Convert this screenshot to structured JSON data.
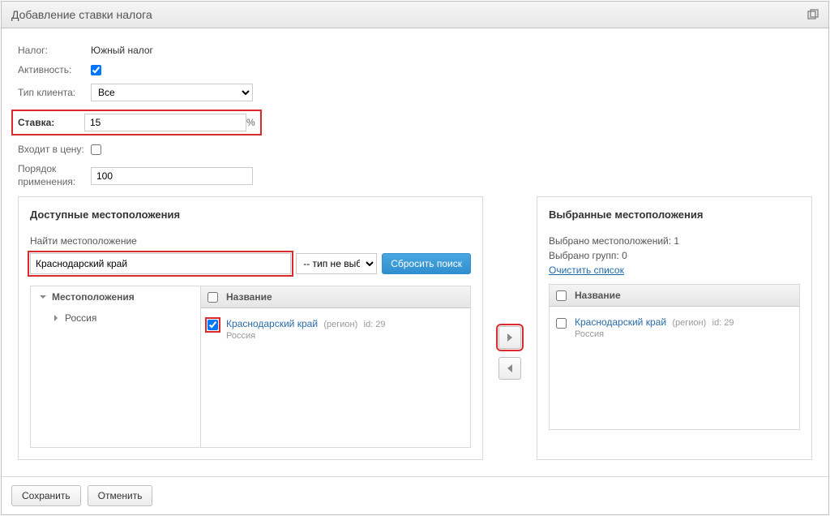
{
  "window": {
    "title": "Добавление ставки налога"
  },
  "form": {
    "tax_label": "Налог:",
    "tax_value": "Южный налог",
    "active_label": "Активность:",
    "active_checked": true,
    "client_type_label": "Тип клиента:",
    "client_type_value": "Все",
    "rate_label": "Ставка:",
    "rate_value": "15",
    "rate_unit": "%",
    "in_price_label": "Входит в цену:",
    "in_price_checked": false,
    "order_label": "Порядок применения:",
    "order_value": "100"
  },
  "left_panel": {
    "title": "Доступные местоположения",
    "search_label": "Найти местоположение",
    "search_value": "Краснодарский край",
    "type_placeholder": "-- тип не выбран",
    "reset_label": "Сбросить поиск",
    "tree": {
      "root": "Местоположения",
      "child": "Россия"
    },
    "list_header": "Название",
    "list": {
      "name": "Краснодарский край",
      "meta_type": "(регион)",
      "meta_id": "id: 29",
      "sub": "Россия",
      "checked": true
    }
  },
  "right_panel": {
    "title": "Выбранные местоположения",
    "stats_loc": "Выбрано местоположений: 1",
    "stats_grp": "Выбрано групп: 0",
    "clear_link": "Очистить список",
    "list_header": "Название",
    "list": {
      "name": "Краснодарский край",
      "meta_type": "(регион)",
      "meta_id": "id: 29",
      "sub": "Россия",
      "checked": false
    }
  },
  "footer": {
    "save": "Сохранить",
    "cancel": "Отменить"
  }
}
